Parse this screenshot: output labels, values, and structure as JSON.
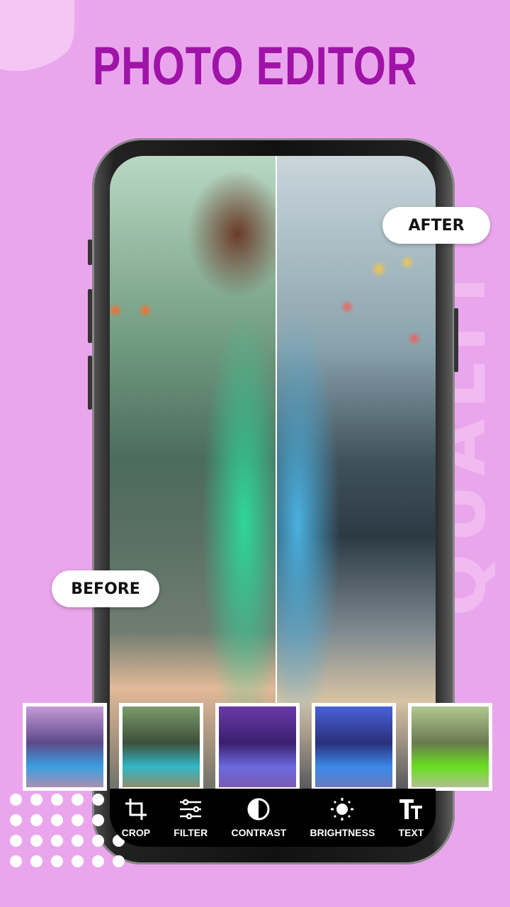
{
  "header": {
    "title": "PHOTO EDITOR"
  },
  "watermark": "QUALITY",
  "labels": {
    "after": "AFTER",
    "before": "BEFORE"
  },
  "thumbnails": [
    {
      "name": "original",
      "tint": "linear-gradient(180deg,#c59ad8,#5d4a8a 45%,#3aa0e0 75%,#a98fb0)"
    },
    {
      "name": "warm",
      "tint": "linear-gradient(180deg,#7a9c6a,#3d4f3a 45%,#32b8c8 75%,#8c8c6a)"
    },
    {
      "name": "purple",
      "tint": "linear-gradient(180deg,#6a3aa8,#3b1f6e 45%,#6a6ae0 75%,#7a5ab0)"
    },
    {
      "name": "blue",
      "tint": "linear-gradient(180deg,#4a62d8,#2a2f7a 45%,#3a8ae8 75%,#6a7ac0)"
    },
    {
      "name": "green",
      "tint": "linear-gradient(180deg,#b0c890,#6a7a50 45%,#6ae020 75%,#b0c090)"
    }
  ],
  "toolbar": [
    {
      "icon": "crop-icon",
      "label": "CROP"
    },
    {
      "icon": "filter-icon",
      "label": "FILTER"
    },
    {
      "icon": "contrast-icon",
      "label": "CONTRAST"
    },
    {
      "icon": "brightness-icon",
      "label": "BRIGHTNESS"
    },
    {
      "icon": "text-icon",
      "label": "TEXT"
    }
  ],
  "colors": {
    "background": "#eaa6ec",
    "title": "#a013a8"
  }
}
